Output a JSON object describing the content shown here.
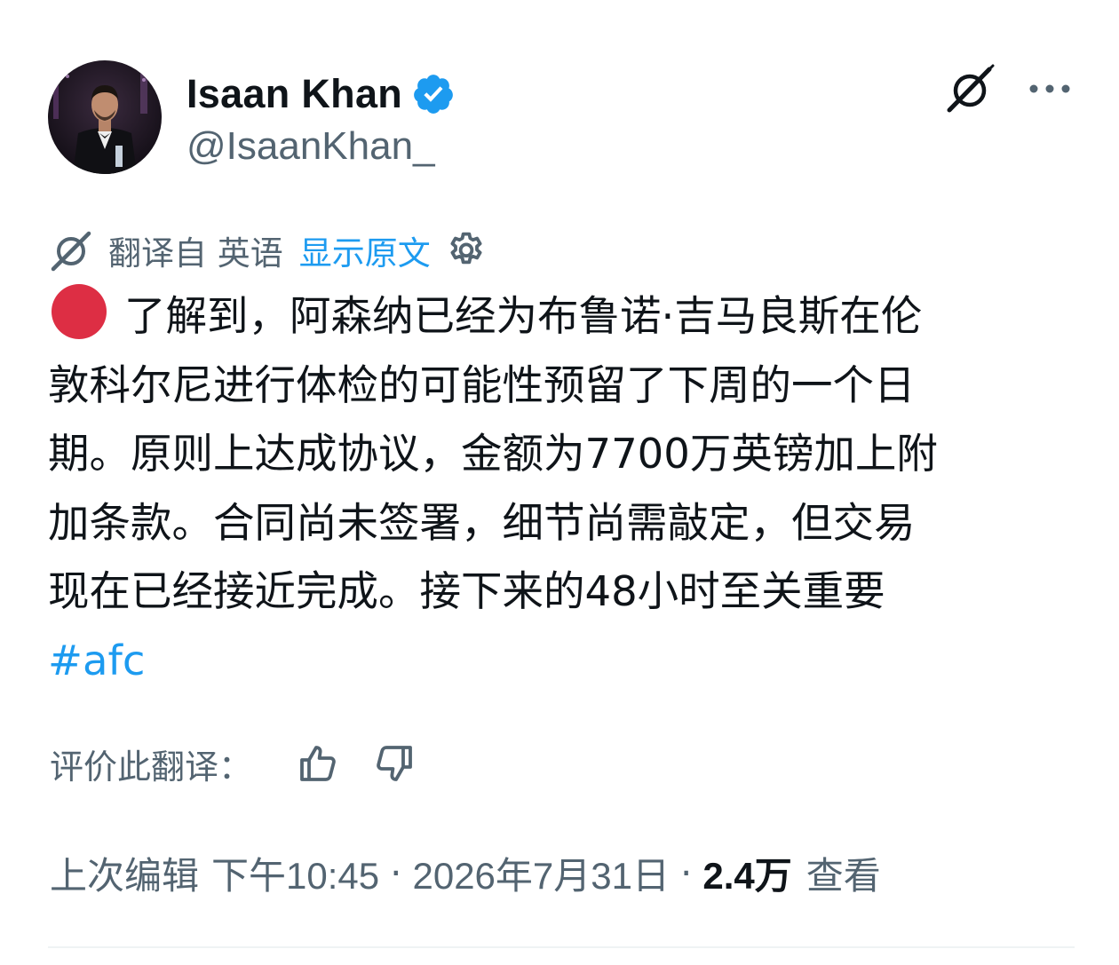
{
  "author": {
    "display_name": "Isaan Khan",
    "handle": "@IsaanKhan_",
    "verified": true,
    "avatar_desc": "man in tuxedo holding an award"
  },
  "icons": {
    "verified": "verified-badge-icon",
    "grok": "grok-icon",
    "more": "more-icon",
    "translate": "translate-icon",
    "settings": "gear-icon",
    "thumbs_up": "thumbs-up-icon",
    "thumbs_down": "thumbs-down-icon"
  },
  "translation": {
    "translated_from": "翻译自 英语",
    "show_original": "显示原文"
  },
  "tweet": {
    "lines": [
      "了解到，阿森纳已经为布鲁诺·吉马良斯在伦",
      "敦科尔尼进行体检的可能性预留了下周的一个日",
      "期。原则上达成协议，金额为7700万英镑加上附",
      "加条款。合同尚未签署，细节尚需敲定，但交易",
      "现在已经接近完成。接下来的48小时至关重要"
    ],
    "hashtag": "#afc"
  },
  "rating": {
    "label": "评价此翻译："
  },
  "meta": {
    "edited_label": "上次编辑",
    "time": "下午10:45",
    "separator": "·",
    "date": "2026年7月31日",
    "views_count": "2.4万",
    "views_label": "查看"
  },
  "colors": {
    "link_blue": "#1d9bf0",
    "text_primary": "#0f1419",
    "text_secondary": "#536471",
    "red_dot": "#dd2e44",
    "verified_blue": "#1d9bf0"
  }
}
